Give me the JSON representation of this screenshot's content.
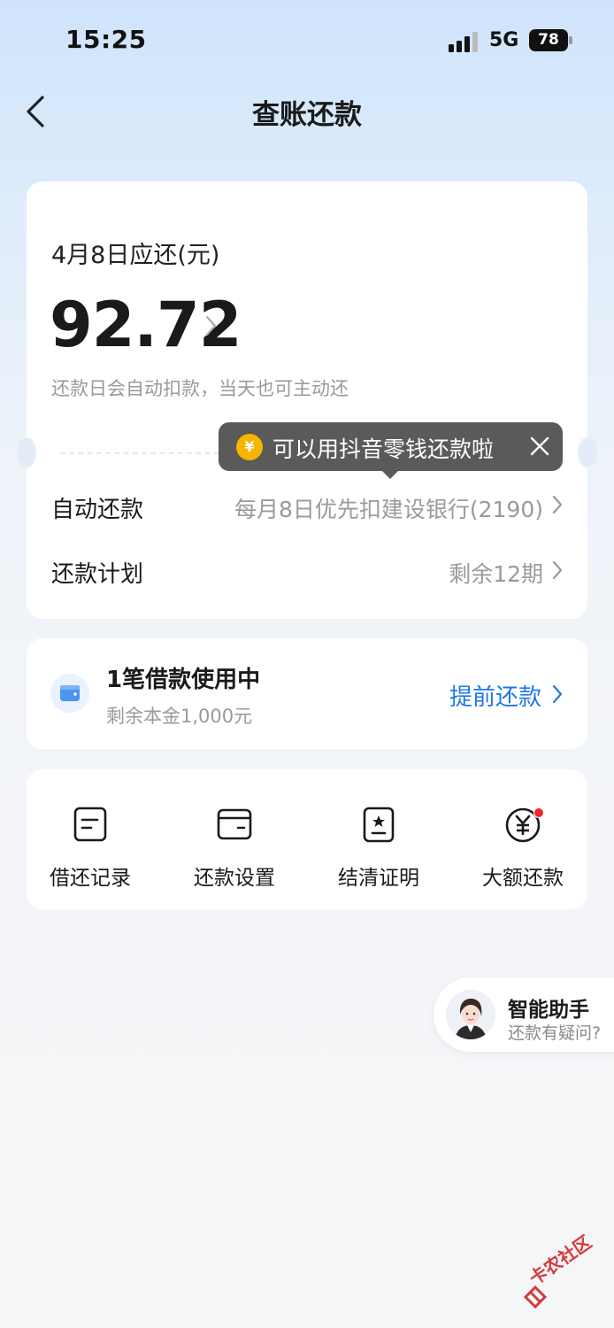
{
  "status_bar": {
    "time": "15:25",
    "network": "5G",
    "battery": "78"
  },
  "nav": {
    "title": "查账还款"
  },
  "bill": {
    "due_label": "4月8日应还(元)",
    "amount": "92.72",
    "hint": "还款日会自动扣款，当天也可主动还",
    "tooltip": "可以用抖音零钱还款啦",
    "tooltip_coin": "¥",
    "auto_repay_label": "自动还款",
    "auto_repay_value": "每月8日优先扣建设银行(2190)",
    "plan_label": "还款计划",
    "plan_value": "剩余12期"
  },
  "loan": {
    "title": "1笔借款使用中",
    "subtitle": "剩余本金1,000元",
    "action": "提前还款"
  },
  "tools": [
    {
      "label": "借还记录",
      "icon": "record-icon"
    },
    {
      "label": "还款设置",
      "icon": "card-icon"
    },
    {
      "label": "结清证明",
      "icon": "certificate-icon"
    },
    {
      "label": "大额还款",
      "icon": "yuan-icon"
    }
  ],
  "assistant": {
    "title": "智能助手",
    "subtitle": "还款有疑问?"
  },
  "watermark": "卡农社区",
  "colors": {
    "accent": "#1e78e6",
    "badge": "#f0262c",
    "coin": "#f7b500"
  }
}
